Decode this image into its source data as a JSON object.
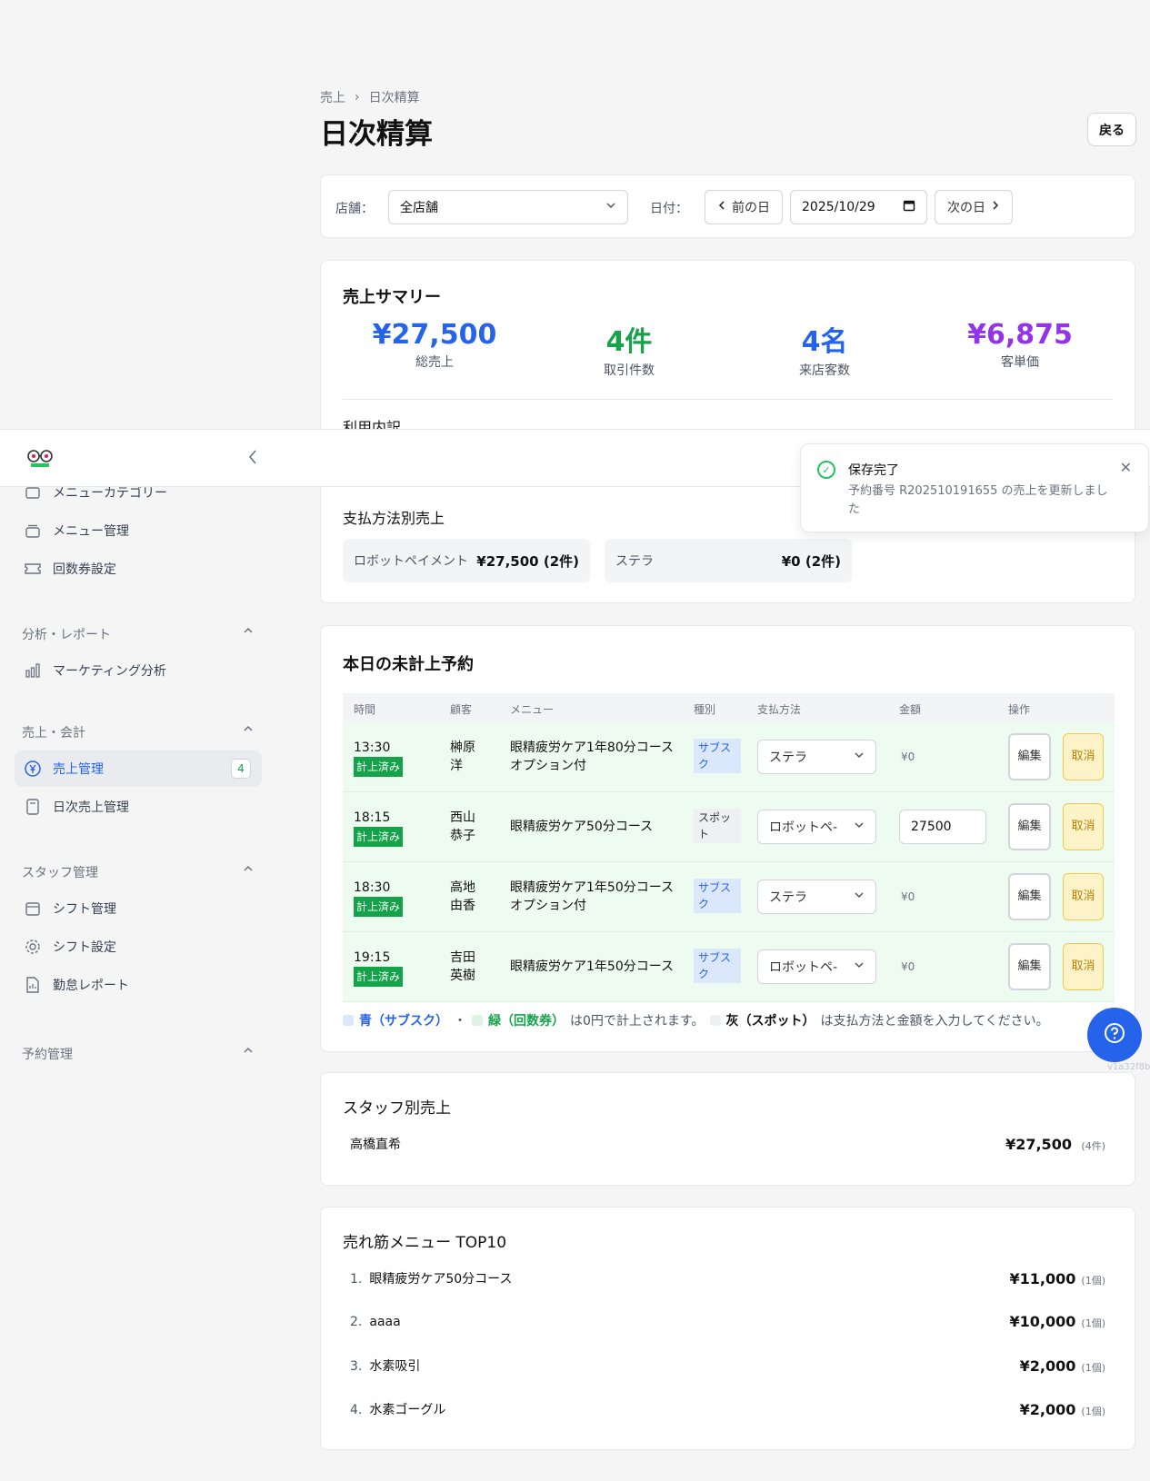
{
  "breadcrumb": {
    "root": "売上",
    "sep": "›",
    "current": "日次精算"
  },
  "page": {
    "title": "日次精算",
    "back_label": "戻る"
  },
  "filter": {
    "store_label": "店舗：",
    "store_value": "全店舗",
    "date_label": "日付：",
    "prev_label": "前の日",
    "date_value": "2025/10/29",
    "next_label": "次の日"
  },
  "summary": {
    "title": "売上サマリー",
    "stats": [
      {
        "value": "¥27,500",
        "label": "総売上",
        "color": "#2563eb"
      },
      {
        "value": "4件",
        "label": "取引件数",
        "color": "#16a34a"
      },
      {
        "value": "4名",
        "label": "来店客数",
        "color": "#2563eb"
      },
      {
        "value": "¥6,875",
        "label": "客単価",
        "color": "#9333ea"
      }
    ],
    "usage_title": "利用内訳",
    "payment_title": "支払方法別売上",
    "payments": [
      {
        "name": "ロボットペイメント",
        "value": "¥27,500 (2件)"
      },
      {
        "name": "ステラ",
        "value": "¥0 (2件)"
      }
    ]
  },
  "pending": {
    "title": "本日の未計上予約",
    "headers": [
      "時間",
      "顧客",
      "メニュー",
      "種別",
      "支払方法",
      "金額",
      "操作"
    ],
    "rows": [
      {
        "time": "13:30",
        "status": "計上済み",
        "customer": "榊原洋",
        "menu": "眼精疲労ケア1年80分コースオプション付",
        "type": "サブスク",
        "payment": "ステラ",
        "amount": "¥0",
        "edit": "編集",
        "cancel": "取消"
      },
      {
        "time": "18:15",
        "status": "計上済み",
        "customer": "西山恭子",
        "menu": "眼精疲労ケア50分コース",
        "type": "スポット",
        "payment": "ロボットペ-",
        "amount": "27500",
        "edit": "編集",
        "cancel": "取消"
      },
      {
        "time": "18:30",
        "status": "計上済み",
        "customer": "高地由香",
        "menu": "眼精疲労ケア1年50分コースオプション付",
        "type": "サブスク",
        "payment": "ステラ",
        "amount": "¥0",
        "edit": "編集",
        "cancel": "取消"
      },
      {
        "time": "19:15",
        "status": "計上済み",
        "customer": "吉田英樹",
        "menu": "眼精疲労ケア1年50分コース",
        "type": "サブスク",
        "payment": "ロボットペ-",
        "amount": "¥0",
        "edit": "編集",
        "cancel": "取消"
      }
    ],
    "note": {
      "blue": "青（サブスク）",
      "sep": "・",
      "green": "緑（回数券）",
      "mid": "は0円で計上されます。",
      "gray": "灰（スポット）",
      "end": "は支払方法と金額を入力してください。"
    }
  },
  "staff": {
    "title": "スタッフ別売上",
    "rows": [
      {
        "name": "高橋直希",
        "value": "¥27,500",
        "count": "(4件)"
      }
    ]
  },
  "top10": {
    "title": "売れ筋メニュー TOP10",
    "rows": [
      {
        "rank": "1.",
        "name": "眼精疲労ケア50分コース",
        "value": "¥11,000",
        "count": "(1個)"
      },
      {
        "rank": "2.",
        "name": "aaaa",
        "value": "¥10,000",
        "count": "(1個)"
      },
      {
        "rank": "3.",
        "name": "水素吸引",
        "value": "¥2,000",
        "count": "(1個)"
      },
      {
        "rank": "4.",
        "name": "水素ゴーグル",
        "value": "¥2,000",
        "count": "(1個)"
      }
    ]
  },
  "sidebar": {
    "items_top": [
      {
        "label": "メニューカテゴリー",
        "icon": "folder-icon"
      },
      {
        "label": "メニュー管理",
        "icon": "layers-icon"
      },
      {
        "label": "回数券設定",
        "icon": "ticket-icon"
      }
    ],
    "sec_analysis": "分析・レポート",
    "marketing": "マーケティング分析",
    "sec_sales": "売上・会計",
    "sales_mgmt": "売上管理",
    "sales_badge": "4",
    "daily_sales": "日次売上管理",
    "sec_staff": "スタッフ管理",
    "shift_mgmt": "シフト管理",
    "shift_settings": "シフト設定",
    "attendance": "勤怠レポート",
    "sec_reservation": "予約管理"
  },
  "toast": {
    "title": "保存完了",
    "message": "予約番号 R202510191655 の売上を更新しました"
  },
  "version": "v1a32f8b"
}
